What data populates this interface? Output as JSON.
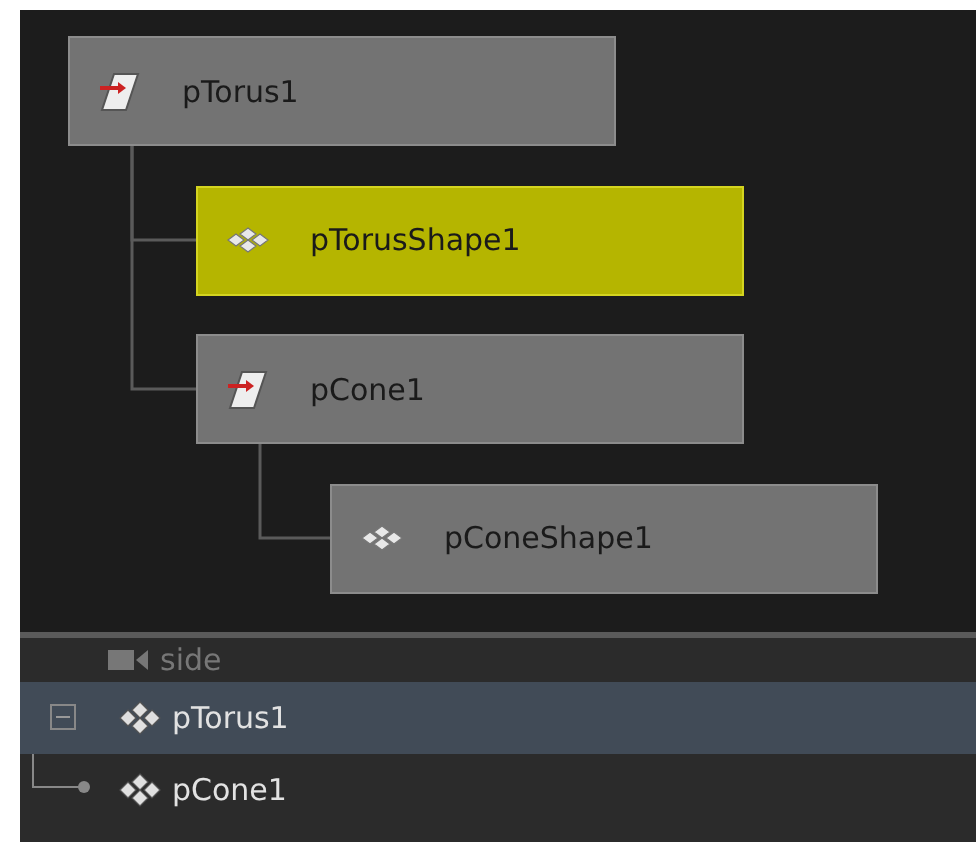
{
  "node_graph": {
    "nodes": [
      {
        "name": "pTorus1",
        "kind": "transform",
        "selected": false,
        "children": [
          {
            "name": "pTorusShape1",
            "kind": "shape",
            "selected": true
          },
          {
            "name": "pCone1",
            "kind": "transform",
            "selected": false,
            "children": [
              {
                "name": "pConeShape1",
                "kind": "shape",
                "selected": false
              }
            ]
          }
        ]
      }
    ]
  },
  "outliner": {
    "items": [
      {
        "name": "side",
        "kind": "camera",
        "hidden": true,
        "selected": false
      },
      {
        "name": "pTorus1",
        "kind": "mesh",
        "hidden": false,
        "selected": true,
        "expanded": true,
        "children": [
          {
            "name": "pCone1",
            "kind": "mesh",
            "hidden": false,
            "selected": false
          }
        ]
      }
    ]
  }
}
